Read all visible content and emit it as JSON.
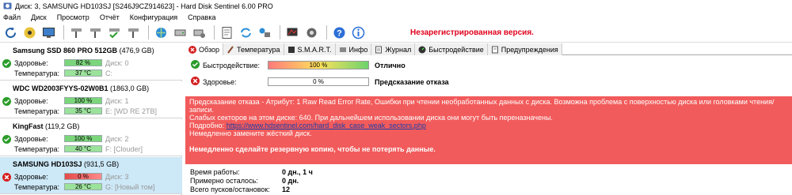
{
  "window": {
    "title": "Диск: 3, SAMSUNG HD103SJ [S246J9CZ914623]  -  Hard Disk Sentinel 6.00 PRO"
  },
  "menu": [
    "Файл",
    "Диск",
    "Просмотр",
    "Отчёт",
    "Конфигурация",
    "Справка"
  ],
  "toolbar": {
    "unregistered": "Незарегистрированная версия."
  },
  "disks": [
    {
      "name": "Samsung SSD 860 PRO 512GB",
      "size": "(476,9 GB)",
      "health_label": "Здоровье:",
      "health": "82 %",
      "health_value": 82,
      "disk_no": "Диск: 0",
      "temp_label": "Температура:",
      "temp": "37 °C",
      "volume": "C:",
      "health_color": "#7bd67b"
    },
    {
      "name": "WDC WD2003FYYS-02W0B1",
      "size": "(1863,0 GB)",
      "health_label": "Здоровье:",
      "health": "100 %",
      "health_value": 100,
      "disk_no": "Диск: 1",
      "temp_label": "Температура:",
      "temp": "35 °C",
      "volume": "E: [WD RE 2TB]",
      "health_color": "#7bd67b"
    },
    {
      "name": "KingFast",
      "size": "(119,2 GB)",
      "health_label": "Здоровье:",
      "health": "100 %",
      "health_value": 100,
      "disk_no": "Диск: 2",
      "temp_label": "Температура:",
      "temp": "40 °C",
      "volume": "F: [Clouder]",
      "health_color": "#7bd67b"
    },
    {
      "name": "SAMSUNG HD103SJ",
      "size": "(931,5 GB)",
      "health_label": "Здоровье:",
      "health": "0 %",
      "health_value": 0,
      "disk_no": "Диск: 3",
      "temp_label": "Температура:",
      "temp": "26 °C",
      "volume": "G: [Новый том]",
      "health_color": "#e34a4a"
    }
  ],
  "tabs": [
    "Обзор",
    "Температура",
    "S.M.A.R.T.",
    "Инфо",
    "Журнал",
    "Быстродействие",
    "Предупреждения"
  ],
  "overview": {
    "perf_label": "Быстродействие:",
    "perf_value": "100 %",
    "perf_status": "Отлично",
    "health_label": "Здоровье:",
    "health_value": "0 %",
    "health_status": "Предсказание отказа"
  },
  "alert": {
    "line1": "Предсказание отказа - Атрибут: 1 Raw Read Error Rate, Ошибки при чтении необработанных данных с диска. Возможна проблема с поверхностью диска или головками чтения/записи.",
    "line2": "Слабых секторов на этом диске: 640. При дальнейшем использовании диска они могут быть переназначены.",
    "more_label": "Подробно:",
    "link": "https://www.hdsentinel.com/hard_disk_case_weak_sectors.php",
    "line4": "Немедленно замените жёсткий диск.",
    "line5": "Немедленно сделайте резервную копию, чтобы не потерять данные."
  },
  "info": [
    {
      "label": "Время работы:",
      "value": "0 дн., 1 ч"
    },
    {
      "label": "Примерно осталось:",
      "value": "0 дн."
    },
    {
      "label": "Всего пусков/остановок:",
      "value": "12"
    }
  ],
  "colors": {
    "alert_bg": "#f25b5b",
    "unregistered": "#e0001b",
    "selected_row": "#cde8f7"
  }
}
